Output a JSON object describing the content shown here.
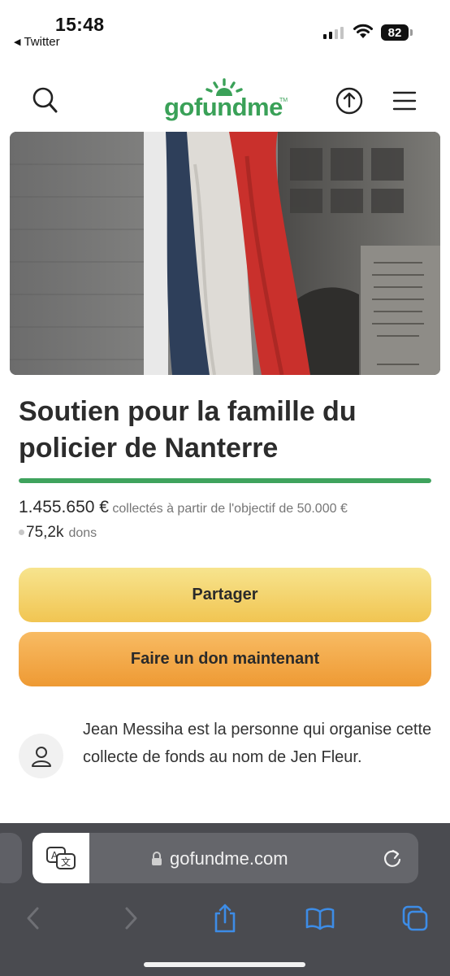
{
  "status_bar": {
    "time": "15:48",
    "back_app": "Twitter",
    "battery": "82",
    "icons": [
      "signal-icon",
      "wifi-icon",
      "battery-icon"
    ]
  },
  "header": {
    "logo": "gofundme",
    "logo_tm": "TM",
    "icons": [
      "search-icon",
      "share-icon",
      "menu-icon"
    ],
    "brand_color": "#3aa158"
  },
  "campaign": {
    "title": "Soutien pour la famille du policier de Nanterre",
    "raised_amount": "1.455.650 €",
    "raised_suffix": "collectés à partir de l'objectif de 50.000 €",
    "donors_count": "75,2k",
    "donors_label": "dons",
    "progress_fraction": 1.0
  },
  "buttons": {
    "share": "Partager",
    "donate": "Faire un don maintenant"
  },
  "organizer": {
    "text": "Jean Messiha est la personne qui organise cette collecte de fonds au nom de Jen Fleur."
  },
  "safari": {
    "url": "gofundme.com",
    "icons": [
      "translate-icon",
      "lock-icon",
      "reload-icon",
      "back-icon",
      "forward-icon",
      "share-icon",
      "bookmarks-icon",
      "tabs-icon"
    ]
  },
  "colors": {
    "progress": "#3fa35d",
    "share_button": "#f1c552",
    "donate_button": "#ee9a34",
    "safari_toolbar": "#4a4b50",
    "safari_accent": "#3d8ce6"
  }
}
